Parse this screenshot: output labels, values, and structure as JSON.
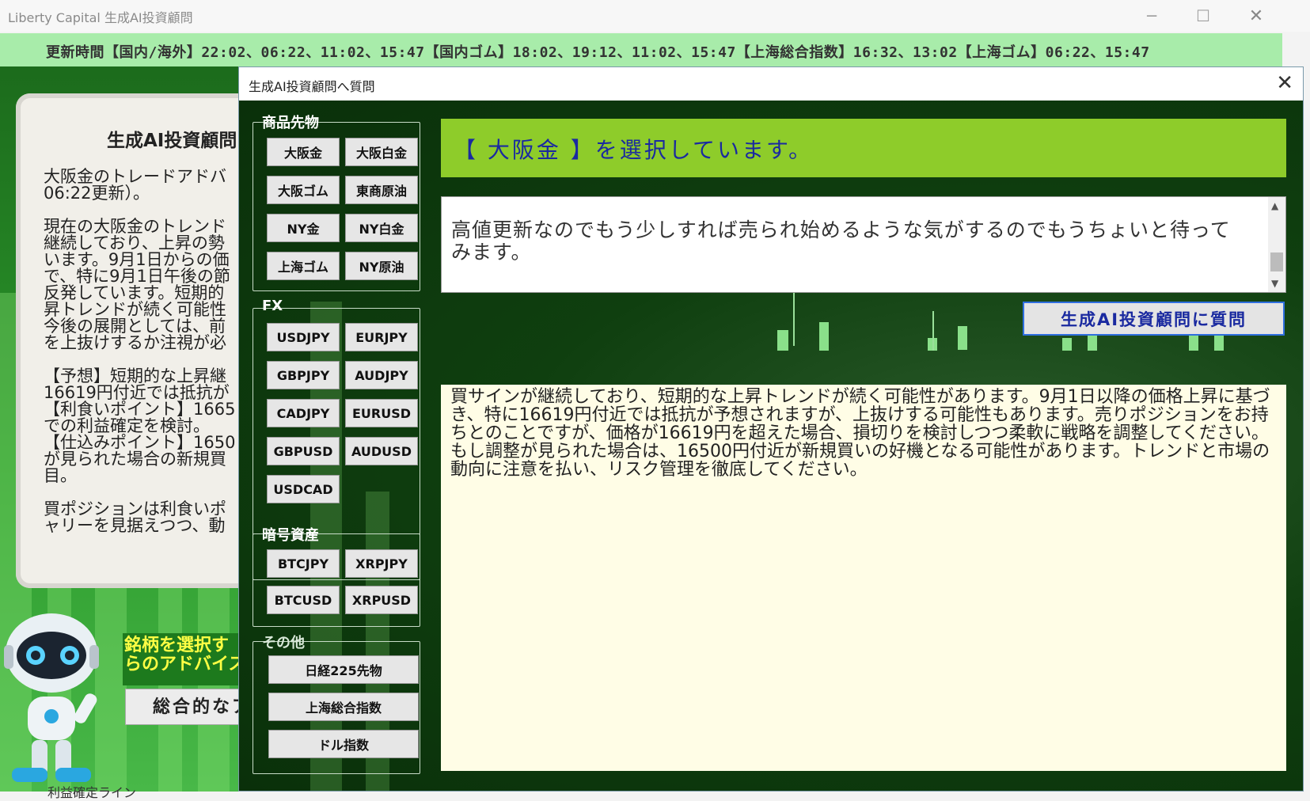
{
  "window": {
    "title": "Liberty Capital 生成AI投資顧問",
    "minimize": "─",
    "maximize": "☐",
    "close": "✕"
  },
  "update_bar": {
    "text": "更新時間【国内/海外】22:02、06:22、11:02、15:47【国内ゴム】18:02、19:12、11:02、15:47【上海総合指数】16:32、13:02【上海ゴム】06:22、15:47"
  },
  "advisor_panel": {
    "title": "生成AI投資顧問",
    "body": "大阪金のトレードアドバ\n06:22更新）。\n\n現在の大阪金のトレンド\n継続しており、上昇の勢\nいます。9月1日からの価\nで、特に9月1日午後の節\n反発しています。短期的\n昇トレンドが続く可能性\n今後の展開としては、前\nを上抜けするか注視が必\n\n【予想】短期的な上昇継\n16619円付近では抵抗が\n【利食いポイント】1665\nでの利益確定を検討。\n【仕込みポイント】1650\nが見られた場合の新規買\n目。\n\n買ポジションは利食いポ\nャリーを見据えつつ、動",
    "yellow_text": "銘柄を選択す\nらのアドバイス",
    "summary_button": "総合的なア",
    "bottom_text": "利益確定ライン"
  },
  "dialog": {
    "title": "生成AI投資顧問へ質問",
    "close": "✕",
    "groups": {
      "commodities": {
        "title": "商品先物",
        "buttons": [
          "大阪金",
          "大阪白金",
          "大阪ゴム",
          "東商原油",
          "NY金",
          "NY白金",
          "上海ゴム",
          "NY原油"
        ]
      },
      "fx": {
        "title": "FX",
        "buttons": [
          "USDJPY",
          "EURJPY",
          "GBPJPY",
          "AUDJPY",
          "CADJPY",
          "EURUSD",
          "GBPUSD",
          "AUDUSD",
          "USDCAD"
        ]
      },
      "crypto": {
        "title": "暗号資産",
        "buttons": [
          "BTCJPY",
          "XRPJPY",
          "BTCUSD",
          "XRPUSD"
        ]
      },
      "other": {
        "title": "その他",
        "buttons": [
          "日経225先物",
          "上海総合指数",
          "ドル指数"
        ]
      }
    },
    "selected_banner": "【 大阪金 】を選択しています。",
    "question_text": "高値更新なのでもう少しすれば売られ始めるような気がするのでもうちょいと待ってみます。",
    "ask_button": "生成AI投資顧問に質問",
    "answer_text": "買サインが継続しており、短期的な上昇トレンドが続く可能性があります。9月1日以降の価格上昇に基づき、特に16619円付近では抵抗が予想されますが、上抜けする可能性もあります。売りポジションをお持ちとのことですが、価格が16619円を超えた場合、損切りを検討しつつ柔軟に戦略を調整してください。もし調整が見られた場合は、16500円付近が新規買いの好機となる可能性があります。トレンドと市場の動向に注意を払い、リスク管理を徹底してください。"
  },
  "colors": {
    "update_bar": "#a8ecaa",
    "banner": "#8ecc2a",
    "banner_text": "#1a2aa0",
    "answer_bg": "#fffde6",
    "ask_border": "#2f6fdf"
  }
}
